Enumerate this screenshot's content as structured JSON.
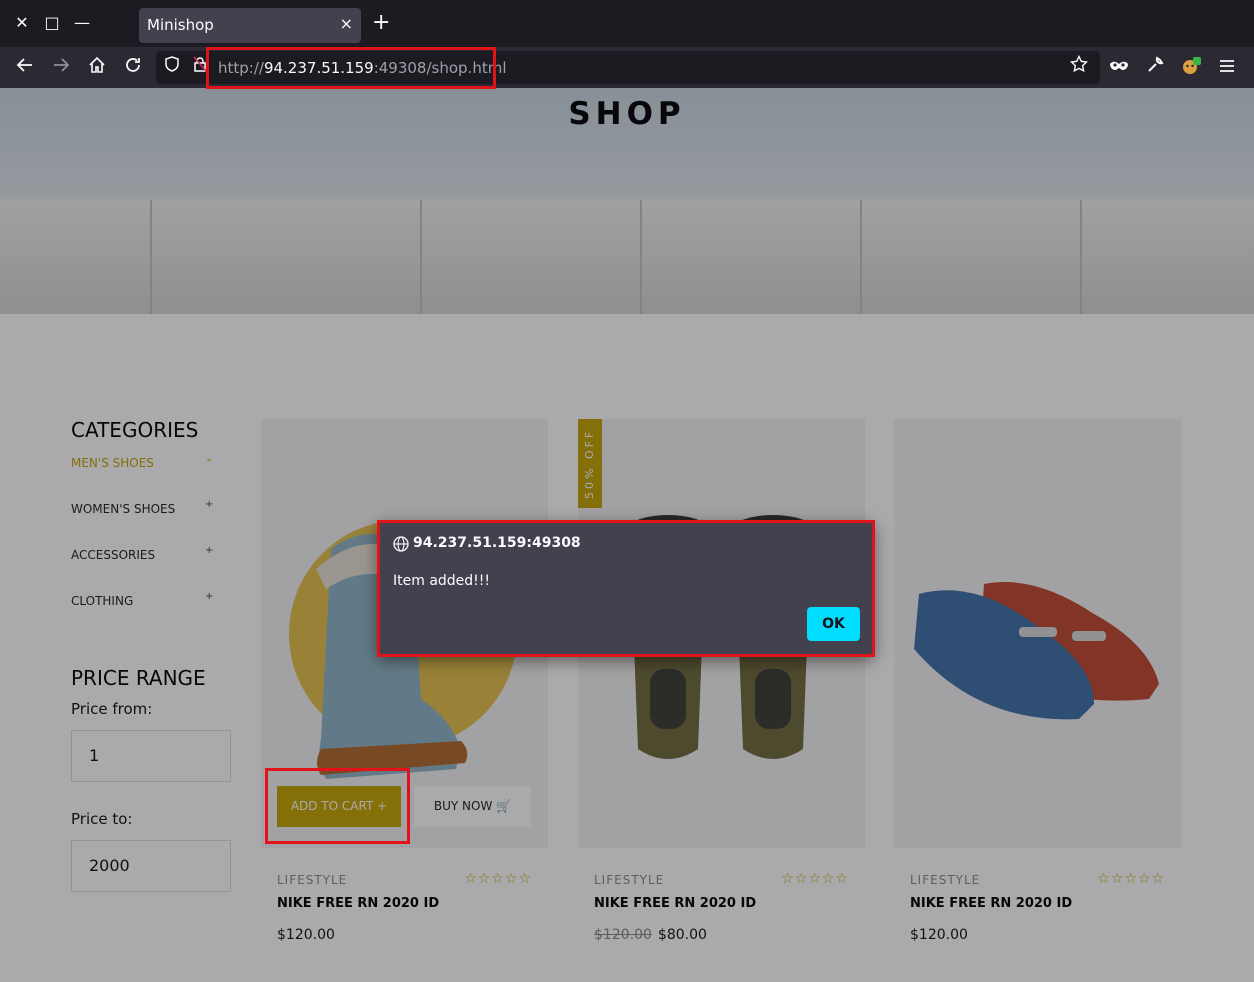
{
  "browser": {
    "tab_title": "Minishop",
    "tab_close_glyph": "×",
    "new_tab_glyph": "+",
    "window_close_glyph": "✕",
    "window_max_glyph": "□",
    "window_min_glyph": "—",
    "url_scheme": "http://",
    "url_host": "94.237.51.159",
    "url_rest": ":49308/shop.html",
    "highlight_color": "#e0121a"
  },
  "hero": {
    "title": "SHOP"
  },
  "sidebar": {
    "categories_title": "CATEGORIES",
    "categories": [
      {
        "label": "MEN'S SHOES",
        "toggle": "⌄"
      },
      {
        "label": "WOMEN'S SHOES",
        "toggle": "+"
      },
      {
        "label": "ACCESSORIES",
        "toggle": "+"
      },
      {
        "label": "CLOTHING",
        "toggle": "+"
      }
    ],
    "price_range_title": "PRICE RANGE",
    "price_from_label": "Price from:",
    "price_from_value": "1",
    "price_to_label": "Price to:",
    "price_to_value": "2000"
  },
  "products": [
    {
      "category": "LIFESTYLE",
      "name": "NIKE FREE RN 2020 ID",
      "price": "$120.00",
      "old_price": "",
      "stars": "☆☆☆☆☆",
      "badge": "",
      "add_to_cart": "ADD TO CART  +",
      "buy_now": "BUY NOW"
    },
    {
      "category": "LIFESTYLE",
      "name": "NIKE FREE RN 2020 ID",
      "price": "$80.00",
      "old_price": "$120.00",
      "stars": "☆☆☆☆☆",
      "badge": "50% OFF"
    },
    {
      "category": "LIFESTYLE",
      "name": "NIKE FREE RN 2020 ID",
      "price": "$120.00",
      "old_price": "",
      "stars": "☆☆☆☆☆",
      "badge": ""
    }
  ],
  "dialog": {
    "origin": "94.237.51.159:49308",
    "message": "Item added!!!",
    "ok_label": "OK"
  },
  "colors": {
    "accent": "#c4a300",
    "dialog_bg": "#42414d",
    "ok_button": "#00ddff"
  }
}
